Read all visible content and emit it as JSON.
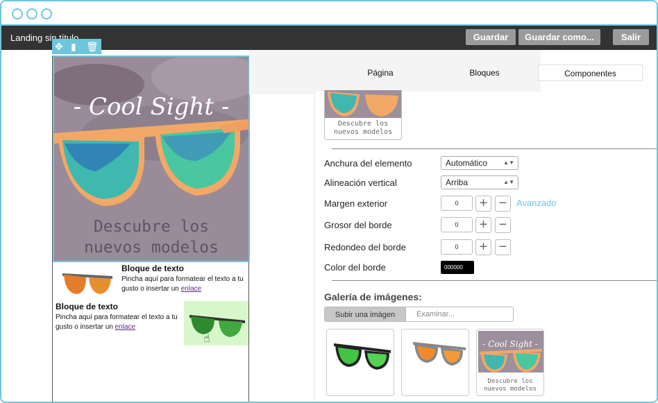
{
  "app": {
    "title": "Landing sin título",
    "buttons": {
      "save": "Guardar",
      "save_as": "Guardar como...",
      "exit": "Salir"
    }
  },
  "selection_toolbar": {
    "icons": [
      "move-icon",
      "copy-icon",
      "trash-icon"
    ]
  },
  "canvas": {
    "hero": {
      "title": "- Cool Sight -",
      "subtitle_line1": "Descubre los",
      "subtitle_line2": "nuevos modelos"
    },
    "text_block_1": {
      "title": "Bloque de texto",
      "text": "Pincha aquí para formatear el texto a tu gusto o insertar un ",
      "link": "enlace"
    },
    "text_block_2": {
      "title": "Bloque de texto",
      "text": "Pincha aquí para formatear el texto a tu gusto o insertar un ",
      "link": "enlace"
    }
  },
  "panel": {
    "tabs": [
      "Página",
      "Bloques",
      "Componentes"
    ],
    "active_tab": "Componentes",
    "thumbnail_caption_line1": "Descubre los",
    "thumbnail_caption_line2": "nuevos modelos",
    "properties": {
      "width_label": "Anchura del elemento",
      "width_value": "Automático",
      "valign_label": "Alineación vertical",
      "valign_value": "Arriba",
      "margin_label": "Margen exterior",
      "margin_value": "0",
      "advanced_link": "Avanzado",
      "border_width_label": "Grosor del borde",
      "border_width_value": "0",
      "border_radius_label": "Redondeo del borde",
      "border_radius_value": "0",
      "border_color_label": "Color del borde",
      "border_color_value": "000000"
    },
    "gallery": {
      "title": "Galería de imágenes:",
      "upload_tab": "Subir una imágen",
      "browse_placeholder": "Examinar...",
      "item3_title": "- Cool Sight -",
      "item3_caption_line1": "Descubre los",
      "item3_caption_line2": "nuevos modelos"
    }
  },
  "colors": {
    "accent": "#6ec6dc",
    "appbar": "#333333",
    "button": "#9b9b9b",
    "highlight": "#d7f7cb",
    "link": "#6ec6dc"
  }
}
